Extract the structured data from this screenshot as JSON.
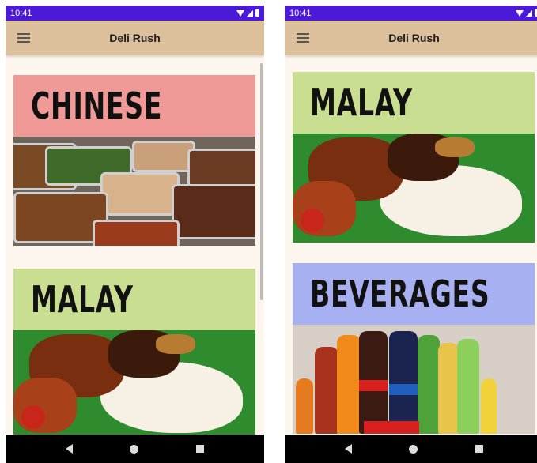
{
  "status_bar": {
    "time": "10:41"
  },
  "app": {
    "title": "Deli Rush"
  },
  "left_screen": {
    "cards": [
      {
        "label": "CHINESE",
        "banner_color": "#f09a98"
      },
      {
        "label": "MALAY",
        "banner_color": "#c9de91"
      }
    ]
  },
  "right_screen": {
    "cards": [
      {
        "label": "MALAY",
        "banner_color": "#c9de91"
      },
      {
        "label": "BEVERAGES",
        "banner_color": "#a7b1f2"
      }
    ]
  },
  "icons": [
    "menu-icon",
    "wifi-icon",
    "signal-icon",
    "battery-icon",
    "back-icon",
    "home-icon",
    "recent-apps-icon"
  ],
  "colors": {
    "status_bar": "#4b19d8",
    "app_bar": "#dcc09b",
    "background": "#fdf6ee"
  }
}
